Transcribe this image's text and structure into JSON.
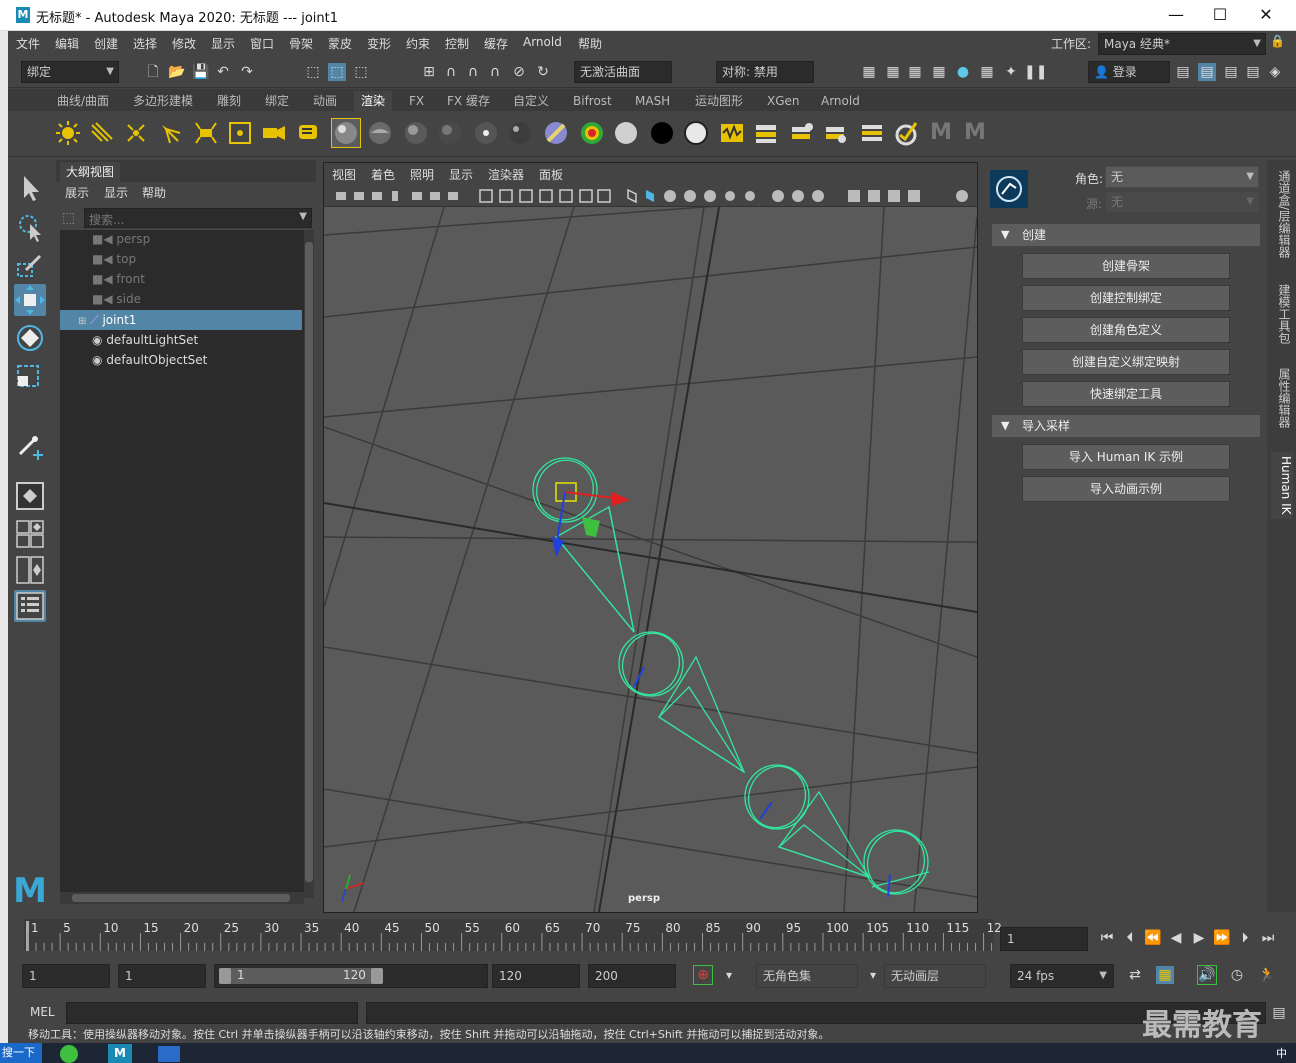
{
  "title_bar": {
    "title": "无标题* - Autodesk Maya 2020: 无标题   ---   joint1",
    "logo": "M"
  },
  "menus": [
    "文件",
    "编辑",
    "创建",
    "选择",
    "修改",
    "显示",
    "窗口",
    "骨架",
    "蒙皮",
    "变形",
    "约束",
    "控制",
    "缓存",
    "Arnold",
    "帮助"
  ],
  "workspace": {
    "label": "工作区:",
    "value": "Maya 经典*"
  },
  "status_line": {
    "mode": "绑定",
    "live_surface": "无激活曲面",
    "symmetry": "对称: 禁用",
    "login": "登录"
  },
  "shelf_tabs": [
    "曲线/曲面",
    "多边形建模",
    "雕刻",
    "绑定",
    "动画",
    "渲染",
    "FX",
    "FX 缓存",
    "自定义",
    "Bifrost",
    "MASH",
    "运动图形",
    "XGen",
    "Arnold"
  ],
  "shelf_active": "渲染",
  "outliner": {
    "title": "大纲视图",
    "menus": [
      "展示",
      "显示",
      "帮助"
    ],
    "search_placeholder": "搜索...",
    "items": [
      {
        "label": "persp",
        "dim": true,
        "icon": "camera-icon"
      },
      {
        "label": "top",
        "dim": true,
        "icon": "camera-icon"
      },
      {
        "label": "front",
        "dim": true,
        "icon": "camera-icon"
      },
      {
        "label": "side",
        "dim": true,
        "icon": "camera-icon"
      },
      {
        "label": "joint1",
        "selected": true,
        "icon": "joint-icon"
      },
      {
        "label": "defaultLightSet",
        "icon": "set-icon"
      },
      {
        "label": "defaultObjectSet",
        "icon": "set-icon"
      }
    ]
  },
  "viewport": {
    "menus": [
      "视图",
      "着色",
      "照明",
      "显示",
      "渲染器",
      "面板"
    ],
    "camera_label": "persp"
  },
  "human_ik": {
    "character_label": "角色:",
    "character_value": "无",
    "source_label": "源:",
    "source_value": "无",
    "section_create": "创建",
    "buttons_create": [
      "创建骨架",
      "创建控制绑定",
      "创建角色定义",
      "创建自定义绑定映射",
      "快速绑定工具"
    ],
    "section_import": "导入采样",
    "buttons_import": [
      "导入 Human IK 示例",
      "导入动画示例"
    ]
  },
  "side_tabs": [
    "通道盒/层编辑器",
    "建模工具包",
    "属性编辑器",
    "Human IK"
  ],
  "timeline": {
    "ticks": [
      "1",
      "5",
      "10",
      "15",
      "20",
      "25",
      "30",
      "35",
      "40",
      "45",
      "50",
      "55",
      "60",
      "65",
      "70",
      "75",
      "80",
      "85",
      "90",
      "95",
      "100",
      "105",
      "110",
      "115",
      "12"
    ],
    "current_frame": "1"
  },
  "range": {
    "start": "1",
    "anim_start": "1",
    "slider_start": "1",
    "slider_end": "120",
    "end": "120",
    "anim_end": "200",
    "char_set": "无角色集",
    "anim_layer": "无动画层",
    "fps": "24 fps"
  },
  "command_line": {
    "lang": "MEL"
  },
  "help_line": "移动工具：使用操纵器移动对象。按住 Ctrl 并单击操纵器手柄可以沿该轴约束移动，按住 Shift 并拖动可以沿轴拖动，按住 Ctrl+Shift 并拖动可以捕捉到活动对象。",
  "watermark": "最需教育",
  "taskbar": {
    "start_text": "搜一下",
    "tray": "中"
  },
  "colors": {
    "selection": "#5285a6",
    "joint": "#33e6a0",
    "viewport_bg": "#5a5a5a"
  }
}
